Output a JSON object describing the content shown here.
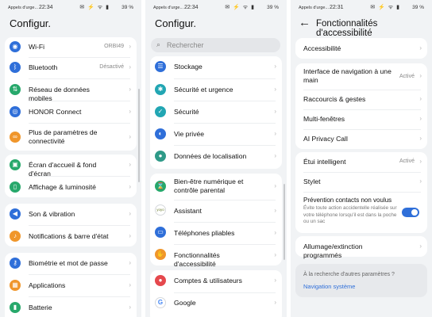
{
  "panel1": {
    "status": {
      "carrier": "Appels d'urge...",
      "time": "22:34",
      "icons": "✉ ⚡ ᯤ ▮",
      "battery": "39 %"
    },
    "title": "Configur.",
    "groups": [
      [
        {
          "label": "Wi-Fi",
          "value": "ORBI49",
          "icon": "wifi-icon",
          "glyph": "◉",
          "color": "#2f6fd9"
        },
        {
          "label": "Bluetooth",
          "value": "Désactivé",
          "icon": "bluetooth-icon",
          "glyph": "ᛒ",
          "color": "#2f6fd9"
        },
        {
          "label": "Réseau de données mobiles",
          "value": "",
          "icon": "mobile-data-icon",
          "glyph": "⇅",
          "color": "#27a86b"
        },
        {
          "label": "HONOR Connect",
          "value": "",
          "icon": "honor-connect-icon",
          "glyph": "◎",
          "color": "#2f6fd9"
        },
        {
          "label": "Plus de paramètres de connectivité",
          "value": "",
          "icon": "link-icon",
          "glyph": "∞",
          "color": "#f0962b"
        }
      ],
      [
        {
          "label": "Écran d'accueil & fond d'écran",
          "value": "",
          "icon": "wallpaper-icon",
          "glyph": "▣",
          "color": "#27a86b"
        },
        {
          "label": "Affichage & luminosité",
          "value": "",
          "icon": "display-icon",
          "glyph": "▯",
          "color": "#27a86b"
        }
      ],
      [
        {
          "label": "Son & vibration",
          "value": "",
          "icon": "sound-icon",
          "glyph": "◀",
          "color": "#2f6fd9"
        },
        {
          "label": "Notifications & barre d'état",
          "value": "",
          "icon": "notifications-icon",
          "glyph": "♪",
          "color": "#f0962b"
        }
      ],
      [
        {
          "label": "Biométrie et mot de passe",
          "value": "",
          "icon": "key-icon",
          "glyph": "⚷",
          "color": "#2f6fd9"
        },
        {
          "label": "Applications",
          "value": "",
          "icon": "apps-icon",
          "glyph": "▦",
          "color": "#f0962b"
        },
        {
          "label": "Batterie",
          "value": "",
          "icon": "battery-icon",
          "glyph": "▮",
          "color": "#27a86b"
        }
      ]
    ]
  },
  "panel2": {
    "status": {
      "carrier": "Appels d'urge...",
      "time": "22:34",
      "icons": "✉ ⚡ ᯤ ▮",
      "battery": "39 %"
    },
    "title": "Configur.",
    "search_placeholder": "Rechercher",
    "groups": [
      [
        {
          "label": "Stockage",
          "icon": "storage-icon",
          "glyph": "☰",
          "color": "#2f6fd9"
        },
        {
          "label": "Sécurité et urgence",
          "icon": "emergency-icon",
          "glyph": "✱",
          "color": "#22a6b3"
        },
        {
          "label": "Sécurité",
          "icon": "security-icon",
          "glyph": "✓",
          "color": "#22a6b3"
        },
        {
          "label": "Vie privée",
          "icon": "privacy-icon",
          "glyph": "◐",
          "color": "#2f6fd9"
        },
        {
          "label": "Données de localisation",
          "icon": "location-icon",
          "glyph": "●",
          "color": "#2f9a88"
        }
      ],
      [
        {
          "label": "Bien-être numérique et contrôle parental",
          "icon": "wellbeing-icon",
          "glyph": "⌛",
          "color": "#27a86b"
        },
        {
          "label": "Assistant",
          "icon": "assistant-icon",
          "glyph": "yoyo",
          "color": "#ffffff"
        },
        {
          "label": "Téléphones pliables",
          "icon": "foldable-icon",
          "glyph": "▭",
          "color": "#2f6fd9"
        },
        {
          "label": "Fonctionnalités d'accessibilité",
          "icon": "accessibility-icon",
          "glyph": "✋",
          "color": "#f0962b"
        }
      ],
      [
        {
          "label": "Comptes & utilisateurs",
          "icon": "accounts-icon",
          "glyph": "●",
          "color": "#e5484d"
        },
        {
          "label": "Google",
          "icon": "google-icon",
          "glyph": "G",
          "color": "#ffffff"
        }
      ]
    ]
  },
  "panel3": {
    "status": {
      "carrier": "Appels d'urge...",
      "time": "22:31",
      "icons": "✉ ⚡ ᯤ ▮",
      "battery": "39 %"
    },
    "title": "Fonctionnalités d'accessibilité",
    "group1": [
      {
        "label": "Accessibilité",
        "value": ""
      }
    ],
    "group2": [
      {
        "label": "Interface de navigation à une main",
        "value": "Activé"
      },
      {
        "label": "Raccourcis & gestes",
        "value": ""
      },
      {
        "label": "Multi-fenêtres",
        "value": ""
      },
      {
        "label": "AI Privacy Call",
        "value": ""
      }
    ],
    "group3": [
      {
        "label": "Étui intelligent",
        "value": "Activé"
      },
      {
        "label": "Stylet",
        "value": ""
      },
      {
        "label": "Prévention contacts non voulus",
        "value": "",
        "desc": "Évite toute action accidentelle réalisée sur votre téléphone lorsqu'il est dans la poche ou un sac",
        "toggle_on": true
      }
    ],
    "group4": [
      {
        "label": "Allumage/extinction programmés",
        "value": ""
      }
    ],
    "suggestion": {
      "question": "À la recherche d'autres paramètres ?",
      "link": "Navigation système"
    }
  }
}
